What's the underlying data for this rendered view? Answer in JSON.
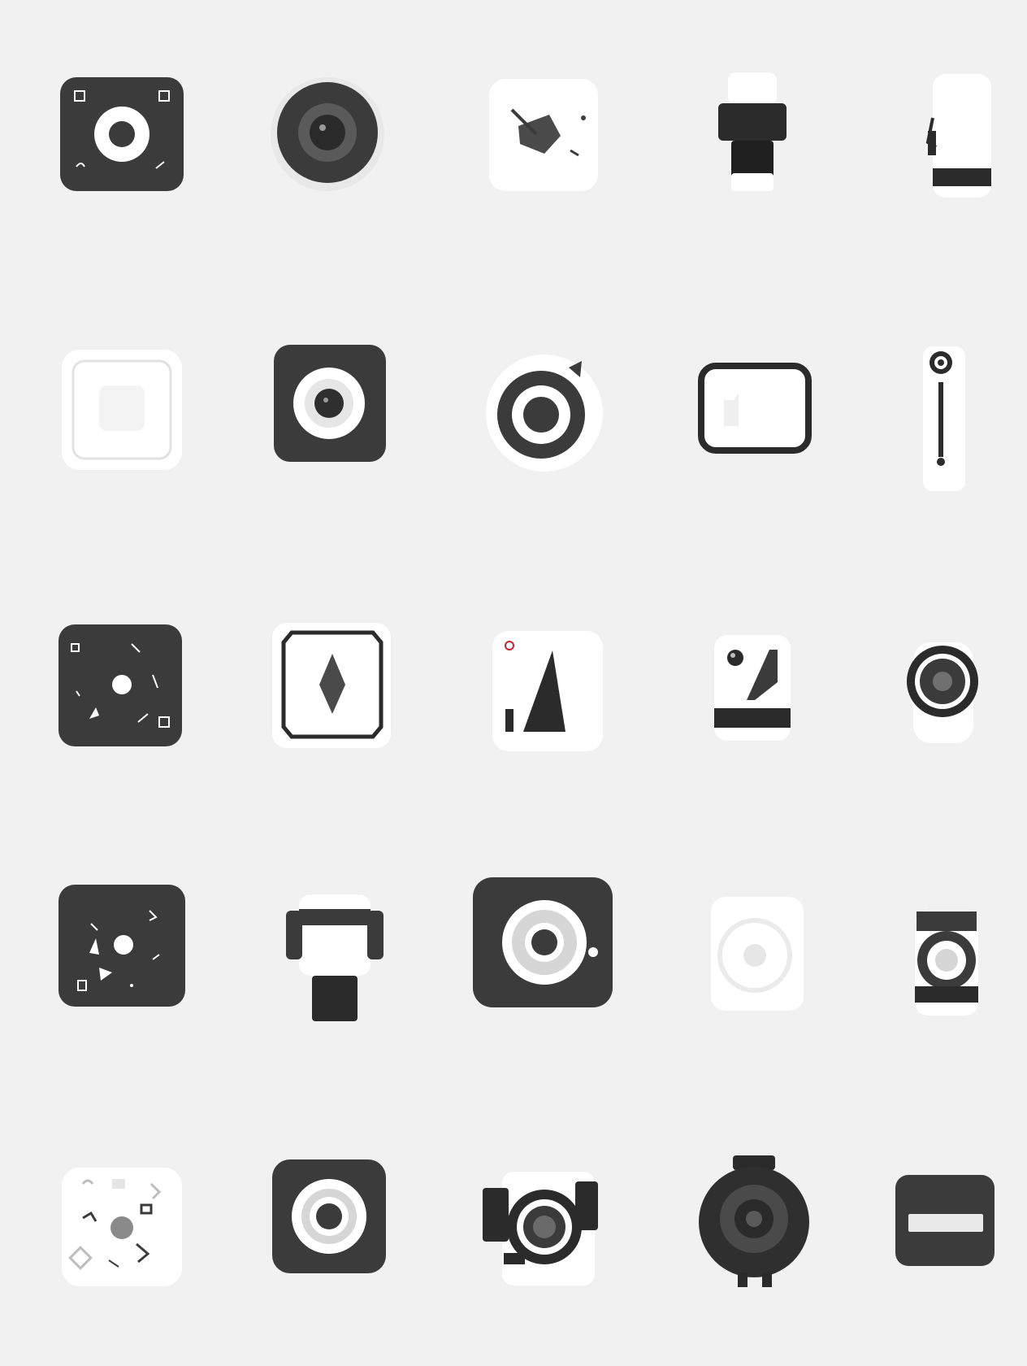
{
  "palette": {
    "background": "#f1f1f1",
    "dark": "#3b3b3b",
    "darker": "#1f1f1f",
    "light": "#ffffff",
    "mid": "#8a8a8a",
    "soft": "#e6e6e6"
  },
  "grid": {
    "rows": 5,
    "columns": 5,
    "icons": [
      {
        "name": "dark-square-ring-camera-icon"
      },
      {
        "name": "round-lens-camera-icon"
      },
      {
        "name": "white-square-action-camera-icon"
      },
      {
        "name": "cylinder-camera-mount-icon"
      },
      {
        "name": "tall-white-camera-body-icon"
      },
      {
        "name": "white-square-tile-icon"
      },
      {
        "name": "dark-square-lens-icon"
      },
      {
        "name": "round-white-lens-knob-icon"
      },
      {
        "name": "rounded-frame-icon"
      },
      {
        "name": "vertical-slider-icon"
      },
      {
        "name": "dark-square-scatter-icon"
      },
      {
        "name": "white-diamond-frame-icon"
      },
      {
        "name": "white-triangle-camera-icon"
      },
      {
        "name": "small-white-face-camera-icon"
      },
      {
        "name": "small-round-webcam-icon"
      },
      {
        "name": "dark-square-scatter-alt-icon"
      },
      {
        "name": "black-white-block-icon"
      },
      {
        "name": "dark-square-big-lens-camera-icon"
      },
      {
        "name": "white-square-soft-lens-icon"
      },
      {
        "name": "clamp-camera-icon"
      },
      {
        "name": "white-square-scatter-icon"
      },
      {
        "name": "dark-square-ring-icon"
      },
      {
        "name": "retro-camera-icon"
      },
      {
        "name": "round-dark-dome-camera-icon"
      },
      {
        "name": "dark-square-dash-icon"
      }
    ]
  }
}
